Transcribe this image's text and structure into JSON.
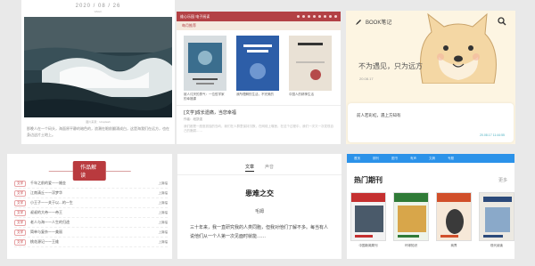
{
  "wave_article": {
    "date": "2020 / 08 / 26",
    "subdate": "WEEK",
    "caption": "图片来源：Unsplash",
    "paragraph": "那晚人在一个码头，海面原平静的暗色的，浪潮在眼前翻涌成白，这是海我们在远方，也在身边这片土地上。"
  },
  "book_list": {
    "brand": "维心乐园 电子阅读",
    "tab": "每月推荐",
    "books": [
      {
        "title": "被人讨厌的勇气：一位哲学家的幸福课",
        "cover_color": "#3b6e8e"
      },
      {
        "title": "我所理解的生活，不完美的",
        "cover_color": "#2d5ea8"
      },
      {
        "title": "中国人的精神生活",
        "cover_color": "#e9e1d5"
      }
    ],
    "article_title": "[文学]成长遗痛，当您幸福",
    "article_meta": "作者：段凯强",
    "article_excerpt": "我们都是一座座孤独的岛屿，我们在人群里保持沉默，在网络上喧嚣，在这个过程中，我们一次又一次发现自己的脆弱……"
  },
  "book_notes": {
    "app_name": "BOOK笔记",
    "quote": "不为遇见，只为远方",
    "quote_date": "20.08.17",
    "note_text": "前人若彩虹，遇上方知有",
    "note_time": "20.08.17 11:44:55"
  },
  "works_list": {
    "heading": "作品解读",
    "rows": [
      {
        "tag": "文学",
        "title": "千年之前的爱——婚金",
        "more": "上篇幅"
      },
      {
        "tag": "文学",
        "title": "江南清丘——浮梦华",
        "more": "上篇幅"
      },
      {
        "tag": "文学",
        "title": "小王子——关于以...的一生",
        "more": "上篇幅"
      },
      {
        "tag": "文学",
        "title": "叔叔的大帝——帝王",
        "more": "上篇幅"
      },
      {
        "tag": "文学",
        "title": "老人与海——人生的归途",
        "more": "上篇幅"
      },
      {
        "tag": "文学",
        "title": "简单与复杂——美丽",
        "more": "上篇幅"
      },
      {
        "tag": "文学",
        "title": "桃花源记——王维",
        "more": "上篇幅"
      }
    ]
  },
  "article_detail": {
    "tab_active": "文章",
    "tab_other": "声音",
    "title": "患难之交",
    "author": "毛姆",
    "body": "三十年来，我一直研究我的人类同胞，但我对他们了解不多。每当有人说他们从一个人第一次见面时就能……"
  },
  "periodicals": {
    "nav": [
      "首页",
      "期刊",
      "图书",
      "有声",
      "文摘",
      "专题"
    ],
    "section_title": "热门期刊",
    "more": "更多",
    "mags": [
      {
        "name": "中国新闻周刊",
        "color": "#c53030"
      },
      {
        "name": "环球知识",
        "color": "#2f7b37"
      },
      {
        "name": "商界",
        "color": "#d14f2a"
      },
      {
        "name": "现代阅读",
        "color": "#ece9e2"
      }
    ]
  },
  "colors": {
    "accent_red": "#b34145",
    "accent_blue": "#2b92e9",
    "note_teal": "#4ab0c0"
  }
}
